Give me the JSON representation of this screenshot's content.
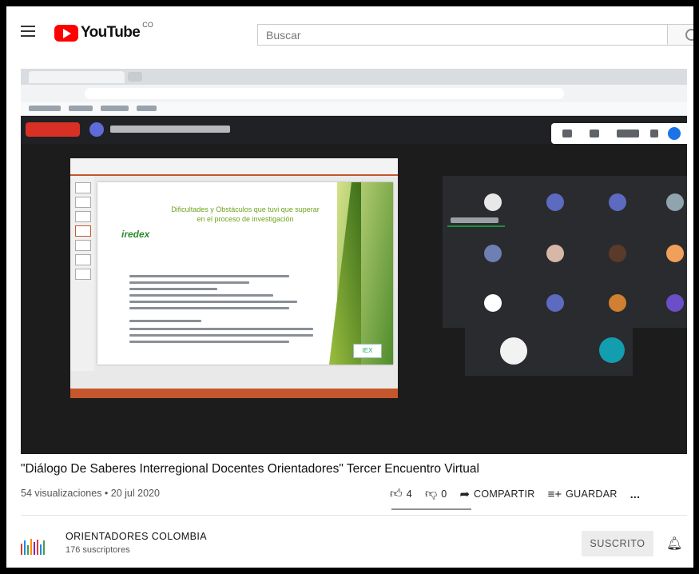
{
  "header": {
    "logo_text": "YouTube",
    "country_code": "CO",
    "search_placeholder": "Buscar"
  },
  "video": {
    "title": "\"Diálogo De Saberes Interregional Docentes Orientadores\" Tercer Encuentro Virtual",
    "stats": "54 visualizaciones • 20 jul 2020",
    "slide_title": "Dificultades y Obstáculos que tuvi que superar en el proceso de investigación"
  },
  "actions": {
    "like_count": "4",
    "dislike_count": "0",
    "share_label": "COMPARTIR",
    "save_label": "GUARDAR",
    "more_label": "..."
  },
  "channel": {
    "name": "ORIENTADORES COLOMBIA",
    "subscribers": "176 suscriptores",
    "subscribe_label": "SUSCRITO"
  },
  "icons": {
    "menu": "hamburger-icon",
    "search": "search-icon",
    "like": "thumb-up-icon",
    "dislike": "thumb-down-icon",
    "share": "share-arrow-icon",
    "save": "playlist-add-icon",
    "bell": "bell-icon"
  },
  "colors": {
    "brand_red": "#ff0000",
    "meet_dark": "#202124",
    "slide_green": "#6fa31b"
  }
}
